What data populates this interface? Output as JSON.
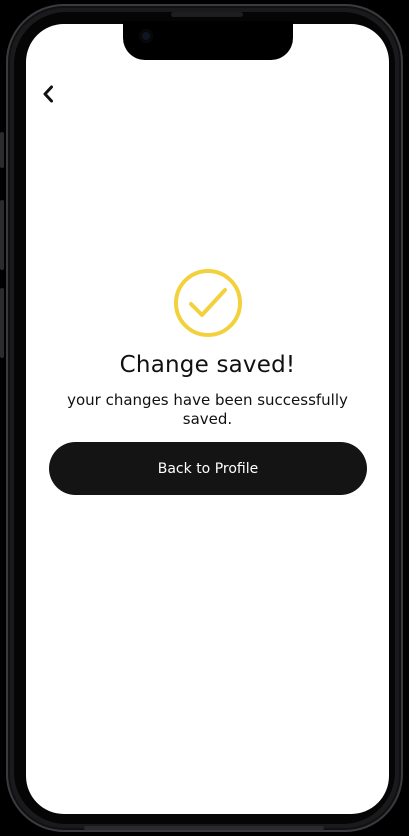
{
  "screen": {
    "title": "Change saved!",
    "message": "your changes have been successfully saved.",
    "primary_button_label": "Back to Profile"
  },
  "icons": {
    "back": "chevron-left-icon",
    "success": "check-circle-icon"
  },
  "colors": {
    "accent": "#F2D13C",
    "button_bg": "#141414",
    "button_text": "#FFFFFF",
    "text": "#111111",
    "background": "#FFFFFF"
  }
}
